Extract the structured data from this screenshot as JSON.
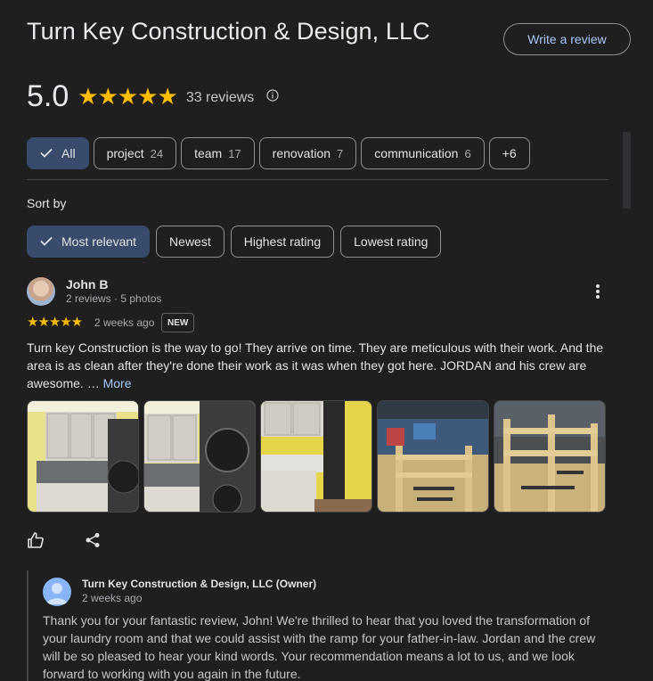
{
  "business": {
    "title": "Turn Key Construction & Design, LLC",
    "write_review": "Write a review",
    "rating": "5.0",
    "stars": "★★★★★",
    "review_count": "33 reviews"
  },
  "topics": [
    {
      "label": "All",
      "count": "",
      "selected": true
    },
    {
      "label": "project",
      "count": "24"
    },
    {
      "label": "team",
      "count": "17"
    },
    {
      "label": "renovation",
      "count": "7"
    },
    {
      "label": "communication",
      "count": "6"
    },
    {
      "label": "+6",
      "count": ""
    }
  ],
  "sort": {
    "label": "Sort by",
    "options": [
      "Most relevant",
      "Newest",
      "Highest rating",
      "Lowest rating"
    ],
    "selected": "Most relevant"
  },
  "review": {
    "author": "John B",
    "meta": "2 reviews · 5 photos",
    "stars": "★★★★★",
    "time": "2 weeks ago",
    "badge": "NEW",
    "text": "Turn key Construction is the way to go! They arrive on time. They are meticulous with their work. And the area is as clean after they're done their work as it was when they got here. JORDAN and his crew are awesome. …",
    "more_label": "More"
  },
  "owner_reply": {
    "name": "Turn Key Construction & Design, LLC (Owner)",
    "time": "2 weeks ago",
    "text": "Thank you for your fantastic review, John! We're thrilled to hear that you loved the transformation of your laundry room and that we could assist with the ramp for your father-in-law. Jordan and the crew will be so pleased to hear your kind words. Your recommendation means a lot to us, and we look forward to working with you again in the future."
  },
  "colors": {
    "background": "#1f1f1f",
    "accent": "#a8c7fa",
    "star": "#fbbc04",
    "selected_chip": "#394b6c"
  }
}
